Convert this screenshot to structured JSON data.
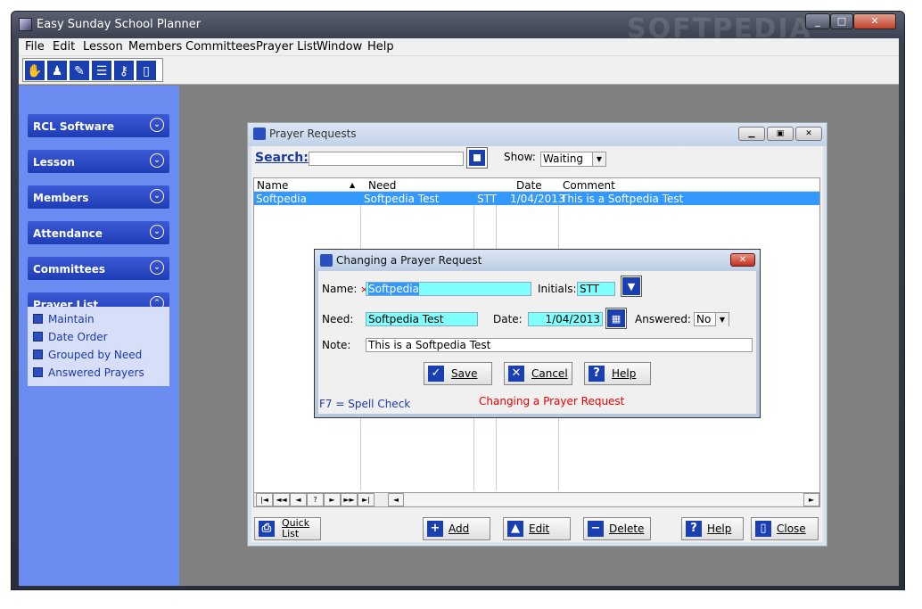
{
  "app": {
    "title": "Easy Sunday School Planner",
    "watermark": "SOFTPEDIA"
  },
  "menu": [
    "File",
    "Edit",
    "Lesson",
    "Members",
    "Committees",
    "Prayer List",
    "Window",
    "Help"
  ],
  "toolbar_icons": [
    "hands-icon",
    "person-icon",
    "pen-icon",
    "group-icon",
    "key-icon",
    "door-icon"
  ],
  "sidebar": {
    "panels": [
      "RCL Software",
      "Lesson",
      "Members",
      "Attendance",
      "Committees",
      "Prayer List"
    ],
    "prayer_items": [
      "Maintain",
      "Date Order",
      "Grouped by Need",
      "Answered Prayers"
    ]
  },
  "prayer_window": {
    "title": "Prayer Requests",
    "search_label": "Search:",
    "search_value": "",
    "show_label": "Show:",
    "show_value": "Waiting",
    "columns": [
      "Name",
      "Need",
      "Date",
      "Comment"
    ],
    "rows": [
      {
        "name": "Softpedia",
        "need": "Softpedia Test",
        "initials": "STT",
        "date": "1/04/2013",
        "comment": "This is a Softpedia Test"
      }
    ],
    "nav": [
      "|◄",
      "◄◄",
      "◄",
      "?",
      "►",
      "►►",
      "►|"
    ],
    "buttons": {
      "quick_list_1": "Quick",
      "quick_list_2": "List",
      "add": "Add",
      "edit": "Edit",
      "delete": "Delete",
      "help": "Help",
      "close": "Close"
    }
  },
  "dialog": {
    "title": "Changing a Prayer Request",
    "name_label": "Name:",
    "name_value": "Softpedia",
    "initials_label": "Initials:",
    "initials_value": "STT",
    "need_label": "Need:",
    "need_value": "Softpedia Test",
    "date_label": "Date:",
    "date_value": "1/04/2013",
    "answered_label": "Answered:",
    "answered_value": "No",
    "note_label": "Note:",
    "note_value": "This is a Softpedia Test",
    "save": "Save",
    "cancel": "Cancel",
    "help": "Help",
    "spell_check": "F7 = Spell Check",
    "status": "Changing a Prayer Request"
  },
  "colors": {
    "accent": "#1a3fb0",
    "sidebar": "#6b8cf0",
    "field_highlight": "#80ffff",
    "selection": "#3399ff",
    "status": "#e00000"
  }
}
